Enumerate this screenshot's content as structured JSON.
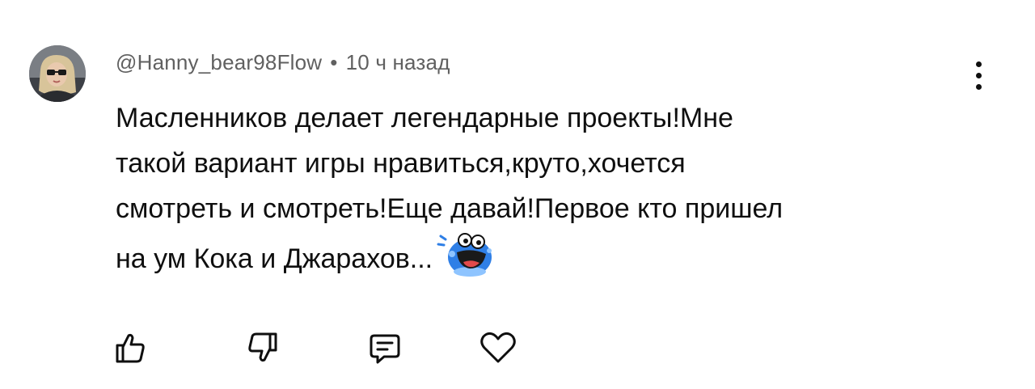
{
  "comment": {
    "author": "@Hanny_bear98Flow",
    "separator": "•",
    "time_ago": "10 ч назад",
    "text_lines": [
      "Масленников делает легендарные проекты!Мне",
      "такой вариант игры нравиться,круто,хочется",
      "смотреть и смотреть!Еще давай!Первое кто пришел",
      "на ум Кока и Джарахов..."
    ],
    "emoji": "laughing-crying-blue-emoji"
  },
  "actions": {
    "like_icon": "thumbs-up-icon",
    "dislike_icon": "thumbs-down-icon",
    "reply_icon": "reply-icon",
    "heart_icon": "heart-icon"
  },
  "menu_icon": "more-vertical-icon",
  "colors": {
    "text": "#0f0f0f",
    "meta": "#606060",
    "emoji_blue": "#2f7fe6"
  }
}
